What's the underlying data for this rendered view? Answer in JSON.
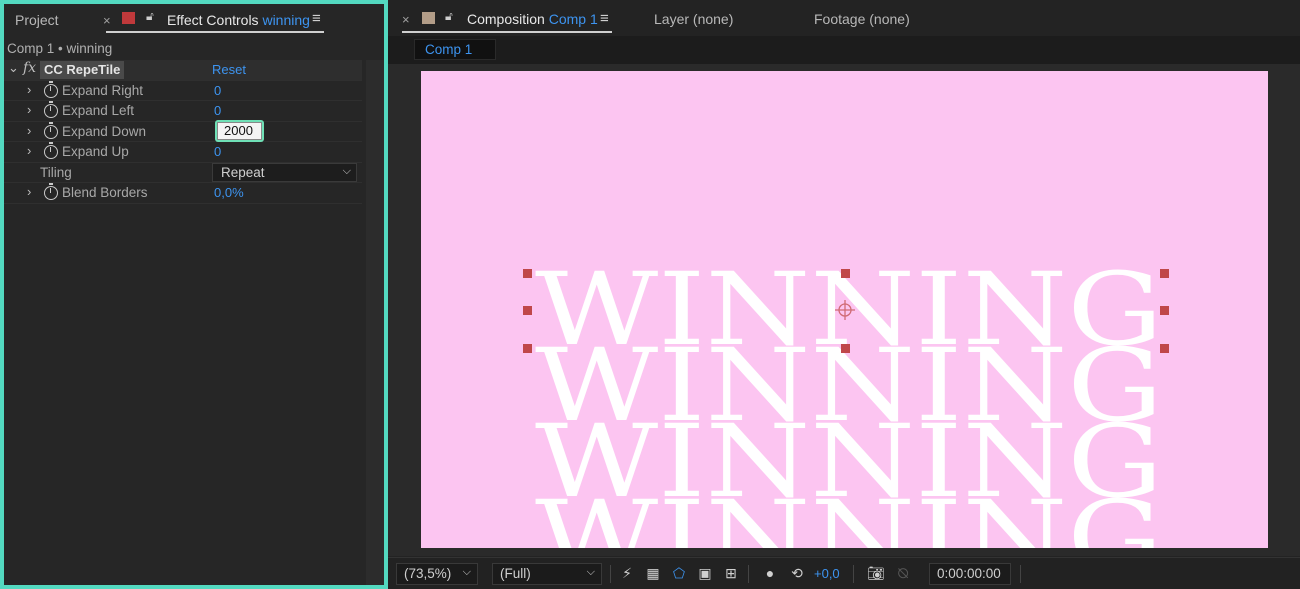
{
  "left_tabs": {
    "project": "Project",
    "effect_controls_prefix": "Effect Controls",
    "effect_controls_layer": "winning",
    "close_glyph": "×",
    "menu_glyph": "≡",
    "swatch_color": "#c0393b"
  },
  "breadcrumb": "Comp 1 • winning",
  "effect": {
    "fx_glyph": "fx",
    "name": "CC RepeTile",
    "reset": "Reset",
    "properties": [
      {
        "label": "Expand Right",
        "value": "0"
      },
      {
        "label": "Expand Left",
        "value": "0"
      },
      {
        "label": "Expand Down",
        "value": "2000"
      },
      {
        "label": "Expand Up",
        "value": "0"
      }
    ],
    "tiling_label": "Tiling",
    "tiling_value": "Repeat",
    "blend_label": "Blend Borders",
    "blend_value": "0,0%"
  },
  "right_tabs": {
    "composition_prefix": "Composition",
    "composition_name": "Comp 1",
    "layer": "Layer (none)",
    "footage": "Footage (none)",
    "swatch_color": "#b39d88",
    "close_glyph": "×",
    "menu_glyph": "≡"
  },
  "subtab": "Comp 1",
  "canvas": {
    "background_color": "#fcc5f1",
    "text_color": "#ffffff",
    "text": "WINNING",
    "handle_color": "#c0474a"
  },
  "bottom_bar": {
    "zoom": "(73,5%)",
    "resolution": "(Full)",
    "exposure": "+0,0",
    "timecode": "0:00:00:00"
  }
}
